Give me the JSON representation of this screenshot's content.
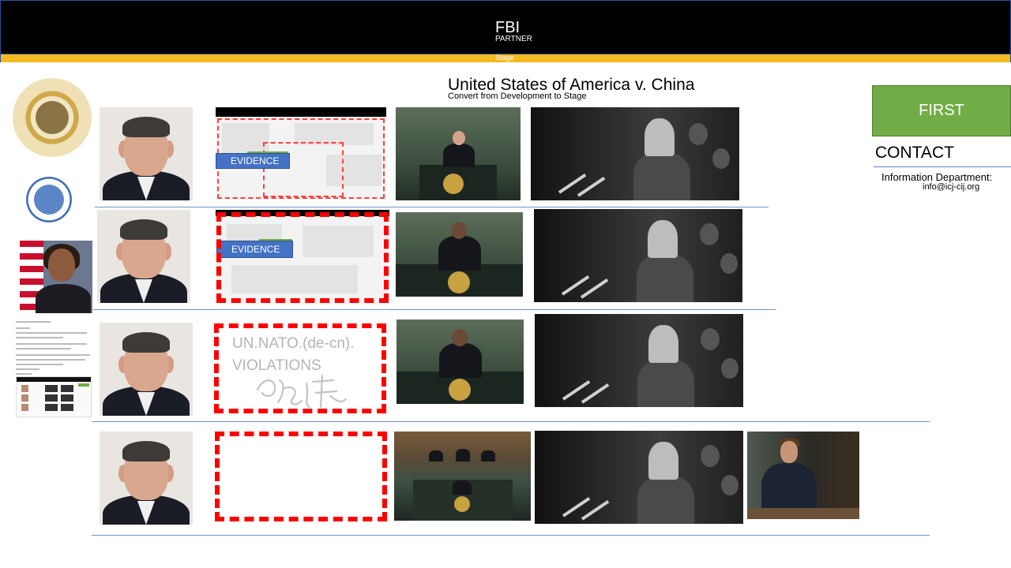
{
  "header": {
    "title": "FBI",
    "subtitle": "PARTNER",
    "stage_label": "Stage"
  },
  "case": {
    "title": "United States of America  v. China",
    "subtitle": "Convert from Development  to Stage"
  },
  "right_panel": {
    "first_button": "FIRST",
    "contact_label": "CONTACT",
    "info_line1": "Information Department:",
    "info_line2": "info@icj-cij.org"
  },
  "rows": [
    {
      "evidence_label": "EVIDENCE"
    },
    {
      "evidence_label": "EVIDENCE"
    },
    {
      "violations_line1": "UN.NATO.(de-cn).",
      "violations_line2": "VIOLATIONS"
    },
    {}
  ],
  "colors": {
    "accent_green": "#71ad47",
    "stage_yellow": "#f5b921",
    "evidence_blue": "#4472c4",
    "dash_red": "#ff0000",
    "divider_blue": "#6f95c8"
  },
  "icons": [
    "court-seal-icon",
    "un-seal-icon"
  ]
}
